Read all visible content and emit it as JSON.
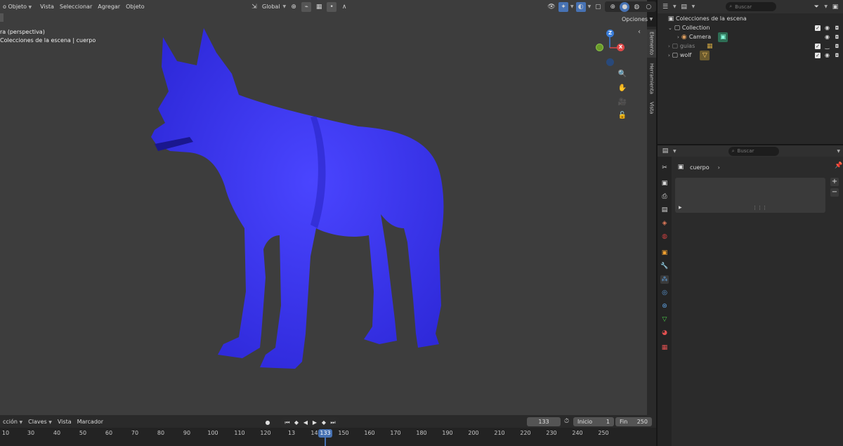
{
  "viewport": {
    "mode_label": "o Objeto",
    "menu": [
      "Vista",
      "Seleccionar",
      "Agregar",
      "Objeto"
    ],
    "transform_orientation": "Global",
    "title_line1": "ra (perspectiva)",
    "title_line2": "Colecciones de la escena | cuerpo",
    "opciones": "Opciones",
    "gizmo": {
      "z": "Z",
      "x": "X",
      "y": "Y"
    },
    "npanel_tabs": [
      "Elemento",
      "Herramienta",
      "Vista"
    ],
    "object_color": "#3a35f2"
  },
  "outliner": {
    "search_placeholder": "Buscar",
    "root": "Colecciones de la escena",
    "rows": [
      {
        "label": "Collection",
        "dim": false
      },
      {
        "label": "Camera",
        "dim": false
      },
      {
        "label": "guias",
        "dim": true
      },
      {
        "label": "wolf",
        "dim": false
      }
    ]
  },
  "properties": {
    "search_placeholder": "Buscar",
    "breadcrumb": "cuerpo"
  },
  "timeline": {
    "menu": [
      "cción",
      "Claves",
      "Vista",
      "Marcador"
    ],
    "current_frame": "133",
    "start_label": "Inicio",
    "start_value": "1",
    "end_label": "Fin",
    "end_value": "250",
    "playhead": "133",
    "ticks": [
      "10",
      "30",
      "40",
      "50",
      "60",
      "70",
      "80",
      "90",
      "100",
      "110",
      "120",
      "13",
      "140",
      "150",
      "160",
      "170",
      "180",
      "190",
      "200",
      "210",
      "220",
      "230",
      "240",
      "250"
    ]
  }
}
